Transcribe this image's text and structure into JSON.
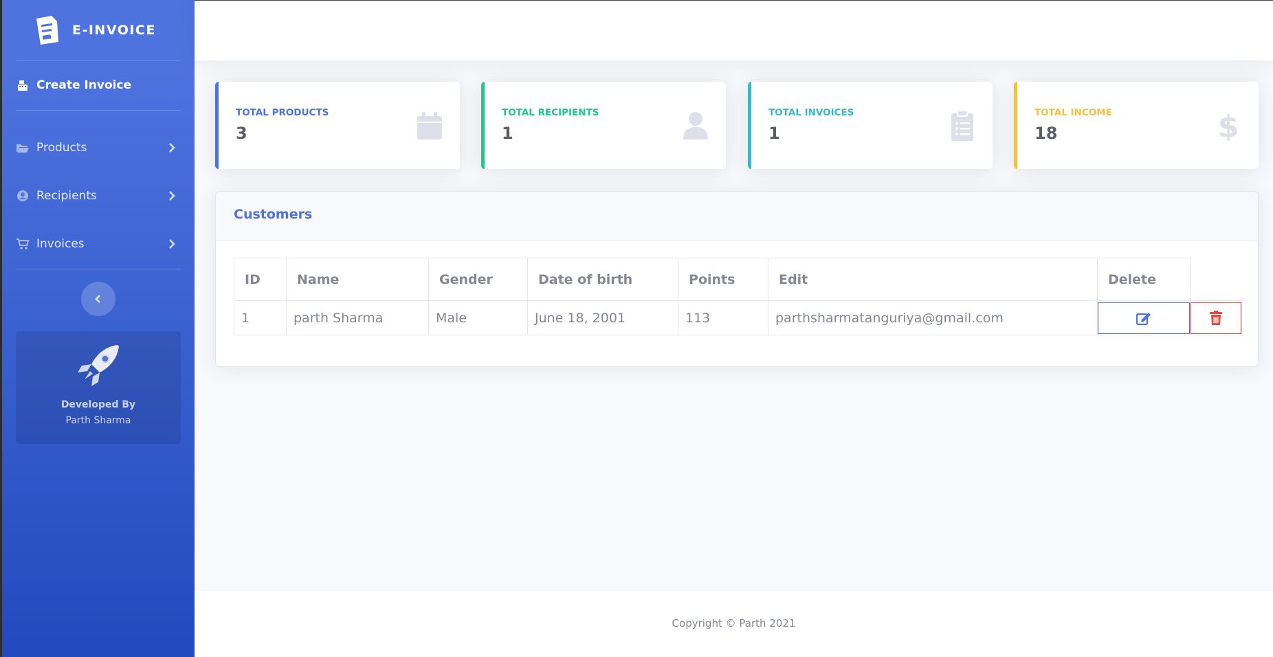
{
  "brand": {
    "name": "E-INVOICE",
    "icon": "invoice-document-icon"
  },
  "sidebar": {
    "create_invoice": {
      "label": "Create Invoice",
      "icon": "cash-register-icon"
    },
    "items": [
      {
        "label": "Products",
        "icon": "folder-open-icon"
      },
      {
        "label": "Recipients",
        "icon": "user-circle-icon"
      },
      {
        "label": "Invoices",
        "icon": "cart-icon"
      }
    ],
    "promo": {
      "title": "Developed By",
      "subtitle": "Parth Sharma",
      "icon": "rocket-icon"
    }
  },
  "stats": [
    {
      "label": "Total Products",
      "value": "3",
      "color": "#4e73df",
      "icon": "calendar-icon"
    },
    {
      "label": "Total Recipients",
      "value": "1",
      "color": "#1cc88a",
      "icon": "user-icon"
    },
    {
      "label": "Total Invoices",
      "value": "1",
      "color": "#36b9cc",
      "icon": "clipboard-list-icon"
    },
    {
      "label": "Total Income",
      "value": "18",
      "color": "#f6c23e",
      "icon": "dollar-icon"
    }
  ],
  "customers": {
    "title": "Customers",
    "columns": [
      "ID",
      "Name",
      "Gender",
      "Date of birth",
      "Points",
      "Edit",
      "Delete"
    ],
    "rows": [
      {
        "id": "1",
        "name": "parth Sharma",
        "gender": "Male",
        "dob": "June 18, 2001",
        "points": "113",
        "email": "parthsharmatanguriya@gmail.com"
      }
    ]
  },
  "footer": {
    "text": "Copyright © Parth 2021"
  }
}
